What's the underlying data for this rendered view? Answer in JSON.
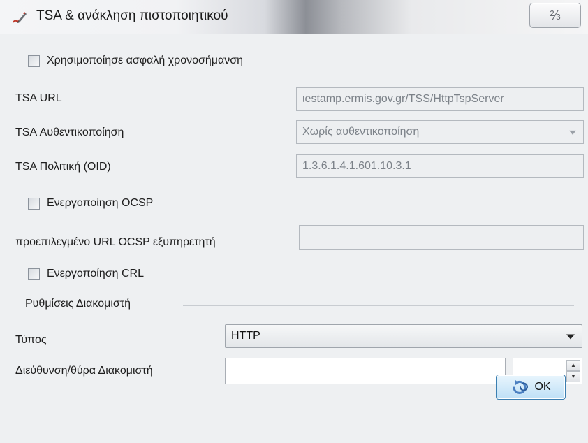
{
  "window": {
    "title": "TSA & ανάκληση πιστοποιητικού",
    "close_glyph": "⅔"
  },
  "secure_timestamp": {
    "label": "Χρησιμοποίησε ασφαλή χρονοσήμανση",
    "checked": false
  },
  "tsa_url": {
    "label": "TSA URL",
    "value": "ιestamp.ermis.gov.gr/TSS/HttpTspServer"
  },
  "tsa_auth": {
    "label": "TSA Αυθεντικοποίηση",
    "value": "Χωρίς αυθεντικοποίηση"
  },
  "tsa_policy": {
    "label": "TSA Πολιτική (OID)",
    "value": "1.3.6.1.4.1.601.10.3.1"
  },
  "ocsp": {
    "label": "Ενεργοποίηση OCSP",
    "checked": false,
    "default_url_label": "προεπιλεγμένο URL OCSP εξυπηρετητή",
    "default_url_value": ""
  },
  "crl": {
    "label": "Ενεργοποίηση CRL",
    "checked": false
  },
  "server_settings": {
    "title": "Ρυθμίσεις Διακομιστή",
    "type_label": "Τύπος",
    "type_value": "HTTP",
    "address_label": "Διεύθυνση/θύρα Διακομιστή",
    "address_value": "",
    "port_value": ""
  },
  "buttons": {
    "ok_label": "OK"
  },
  "icons": {
    "title": "pen-signature-icon",
    "ok": "refresh-arrow-icon"
  }
}
